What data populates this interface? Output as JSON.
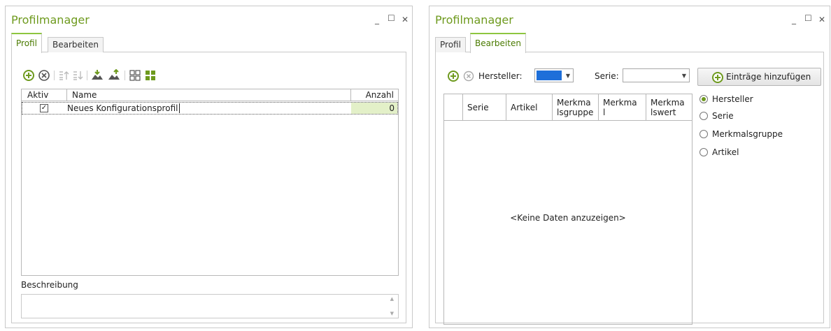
{
  "left": {
    "title": "Profilmanager",
    "tabs": [
      "Profil",
      "Bearbeiten"
    ],
    "active_tab": "Profil",
    "grid": {
      "columns": [
        "Aktiv",
        "Name",
        "Anzahl"
      ],
      "rows": [
        {
          "active": true,
          "name": "Neues Konfigurationsprofil",
          "count": "0"
        }
      ]
    },
    "description_label": "Beschreibung",
    "description_value": ""
  },
  "right": {
    "title": "Profilmanager",
    "tabs": [
      "Profil",
      "Bearbeiten"
    ],
    "active_tab": "Bearbeiten",
    "hersteller_label": "Hersteller:",
    "serie_label": "Serie:",
    "add_button_label": "Einträge hinzufügen",
    "grid": {
      "columns": [
        "Serie",
        "Artikel",
        "Merkma\nlsgruppe",
        "Merkma\nl",
        "Merkma\nlswert"
      ],
      "empty_text": "<Keine Daten anzuzeigen>"
    },
    "radio_options": [
      "Hersteller",
      "Serie",
      "Merkmalsgruppe",
      "Artikel"
    ],
    "radio_selected": "Hersteller"
  },
  "colors": {
    "accent": "#6e9a1e",
    "highlight": "#e3f0c8",
    "selection": "#1e6fd9"
  }
}
